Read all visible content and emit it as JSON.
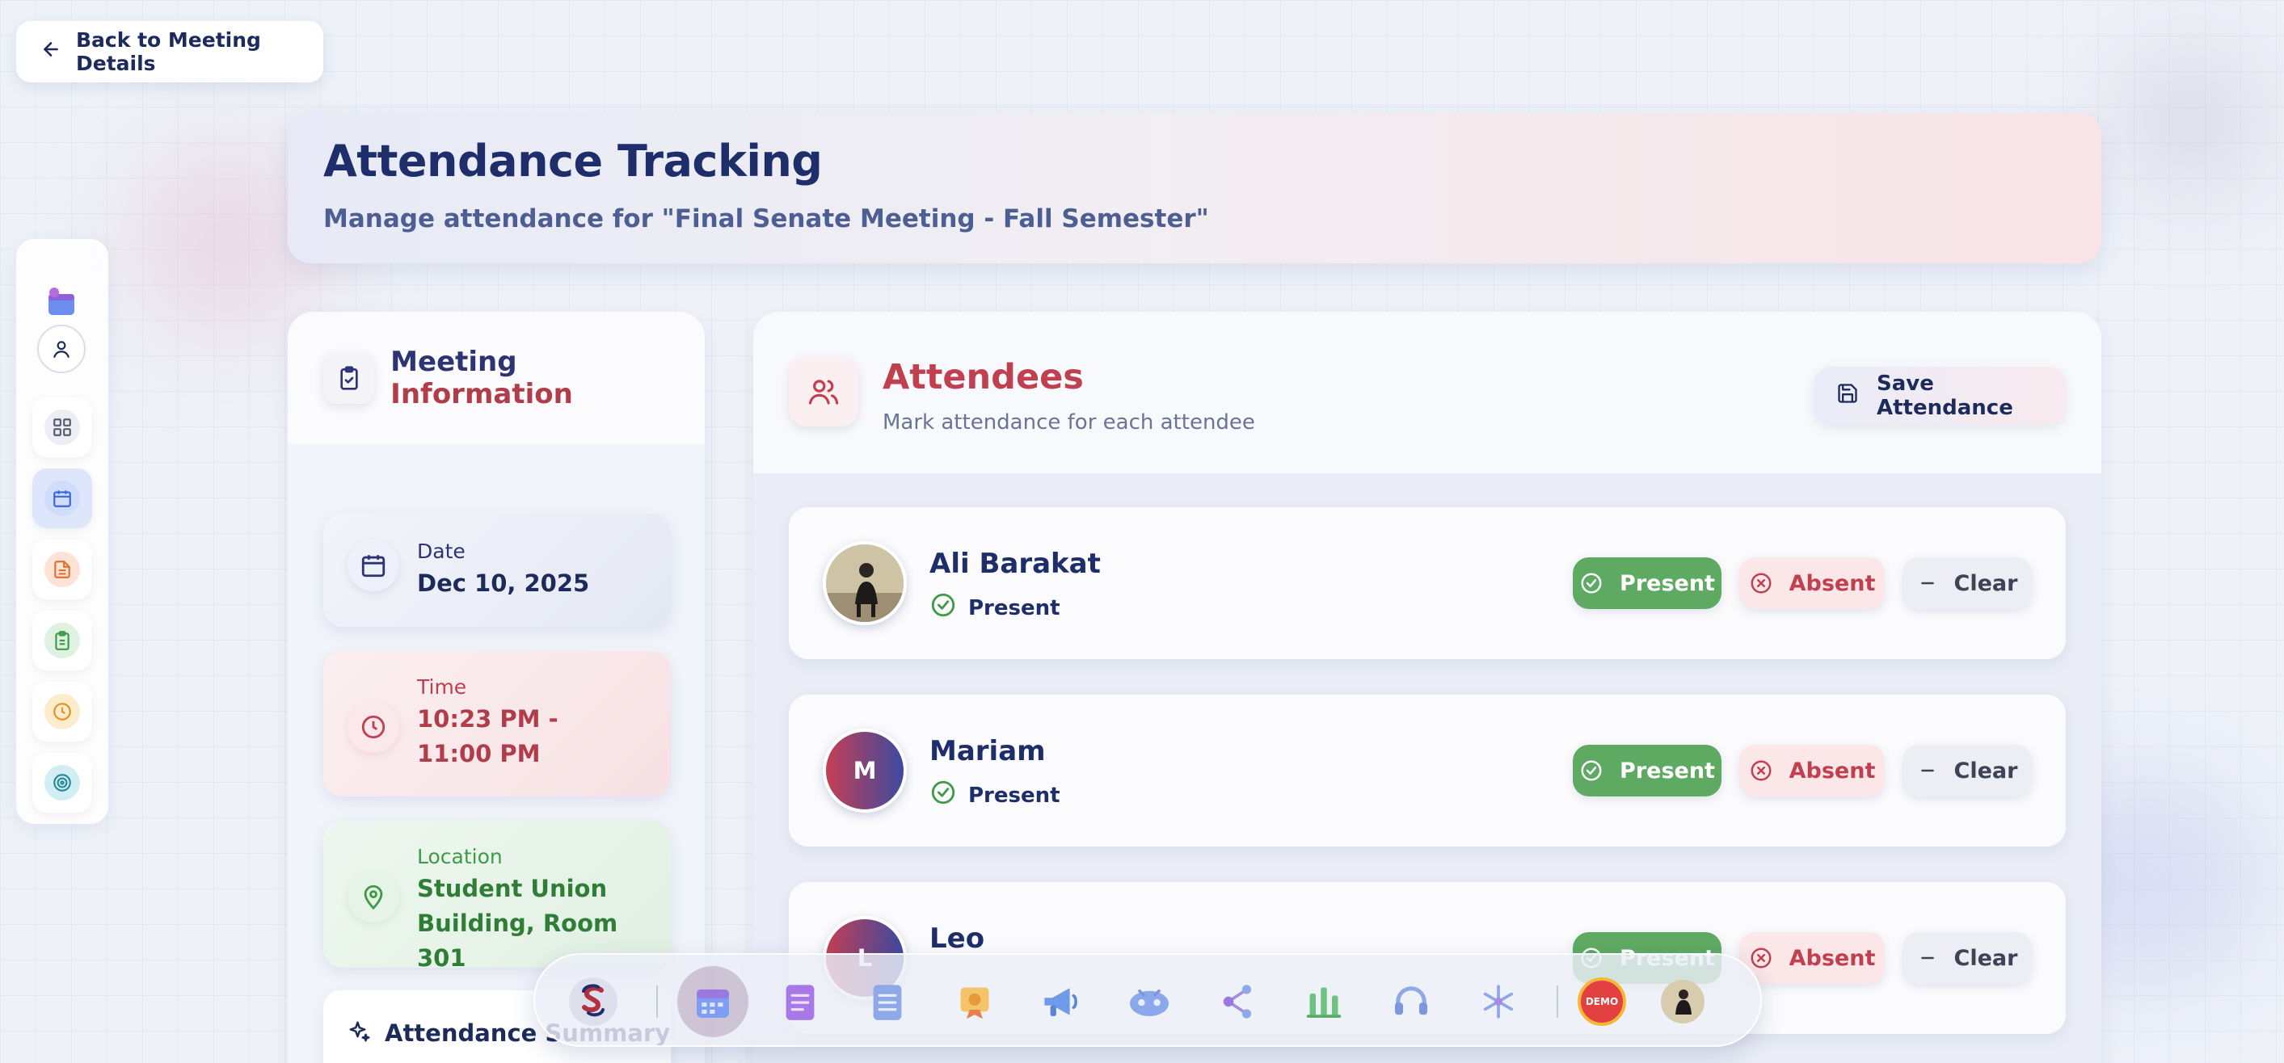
{
  "back_button": {
    "label": "Back to Meeting Details"
  },
  "header": {
    "title": "Attendance Tracking",
    "subtitle": "Manage attendance for \"Final Senate Meeting - Fall Semester\""
  },
  "meeting_info": {
    "title_part1": "Meeting ",
    "title_part2": "Information",
    "date": {
      "label": "Date",
      "value": "Dec 10, 2025"
    },
    "time": {
      "label": "Time",
      "value": "10:23 PM - 11:00 PM"
    },
    "location": {
      "label": "Location",
      "value": "Student Union Building, Room 301"
    },
    "summary": {
      "label": "Attendance Summary"
    }
  },
  "attendees": {
    "title": "Attendees",
    "subtitle": "Mark attendance for each attendee",
    "save_label": "Save Attendance",
    "present_label": "Present",
    "absent_label": "Absent",
    "clear_label": "Clear",
    "rows": [
      {
        "name": "Ali Barakat",
        "status": "Present",
        "avatar": "photo",
        "initial": ""
      },
      {
        "name": "Mariam",
        "status": "Present",
        "avatar": "initial",
        "initial": "M"
      },
      {
        "name": "Leo",
        "status": "",
        "avatar": "initial",
        "initial": "L"
      }
    ]
  },
  "dock": {
    "items": [
      "app-logo-icon",
      "calendar-icon",
      "notes-icon",
      "document-icon",
      "certificate-icon",
      "megaphone-icon",
      "robot-icon",
      "network-icon",
      "chart-icon",
      "headset-icon",
      "snowflake-icon",
      "demo-badge-icon",
      "user-avatar-icon"
    ],
    "demo_badge": "DEMO"
  },
  "colors": {
    "navy": "#1d2e6b",
    "red": "#c0404f",
    "green": "#5faa63",
    "subtle": "#697594"
  }
}
